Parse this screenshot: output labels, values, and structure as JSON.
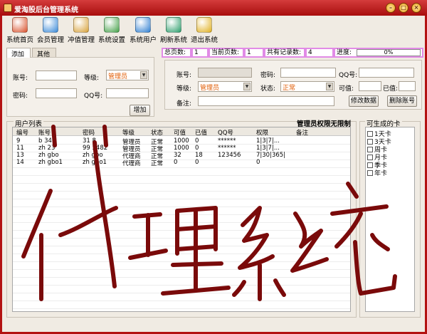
{
  "window": {
    "title": "爱淘股后台管理系统"
  },
  "toolbar": [
    {
      "label": "系统首页",
      "icon": "home-icon",
      "color": "#d9512c"
    },
    {
      "label": "会员管理",
      "icon": "members-icon",
      "color": "#3a8ad8"
    },
    {
      "label": "冲值管理",
      "icon": "recharge-icon",
      "color": "#d8a23a"
    },
    {
      "label": "系统设置",
      "icon": "settings-icon",
      "color": "#43a047"
    },
    {
      "label": "系统用户",
      "icon": "system-user-icon",
      "color": "#2f7fd1"
    },
    {
      "label": "刷新系统",
      "icon": "refresh-icon",
      "color": "#2a9d6a"
    },
    {
      "label": "退出系统",
      "icon": "exit-icon",
      "color": "#e0b020"
    }
  ],
  "tabs": [
    "添加",
    "其他"
  ],
  "add_form": {
    "account_label": "账号:",
    "level_label": "等级:",
    "level_value": "管理员",
    "password_label": "密码:",
    "qq_label": "QQ号:",
    "add_button": "增加"
  },
  "stats": {
    "total_pages_label": "总页数:",
    "total_pages": "1",
    "current_page_label": "当前页数:",
    "current_page": "1",
    "records_label": "共有记录数:",
    "records": "4",
    "progress_label": "进度:",
    "progress_text": "0%",
    "progress_value": 0
  },
  "edit_form": {
    "account_label": "账号:",
    "password_label": "密码:",
    "qq_label": "QQ号:",
    "level_label": "等级:",
    "level_value": "管理员",
    "status_label": "状态:",
    "status_value": "正常",
    "available_label": "可值:",
    "used_label": "已值:",
    "note_label": "备注:",
    "modify_button": "修改数据",
    "delete_button": "删除账号"
  },
  "user_list": {
    "title": "用户列表",
    "permission_note": "管理员权限无限制",
    "columns": [
      "编号",
      "账号",
      "密码",
      "等级",
      "状态",
      "可值",
      "已值",
      "QQ号",
      "权限",
      "备注"
    ],
    "rows": [
      [
        "9",
        "b  341",
        "31  8",
        "管理员",
        "正常",
        "1000",
        "0",
        "******",
        "1|3|7|...",
        ""
      ],
      [
        "11",
        "zh  23",
        "99  5482",
        "管理员",
        "正常",
        "1000",
        "0",
        "******",
        "1|3|7|...",
        ""
      ],
      [
        "13",
        "zh  gbo",
        "zh  gbo",
        "代理商",
        "正常",
        "32",
        "18",
        "123456",
        "7|30|365|",
        ""
      ],
      [
        "14",
        "zh  gbo1",
        "zh  gbo1",
        "代理商",
        "正常",
        "0",
        "0",
        "",
        "0",
        ""
      ]
    ]
  },
  "cards": {
    "title": "可生成的卡",
    "items": [
      "1天卡",
      "3天卡",
      "周卡",
      "月卡",
      "季卡",
      "年卡"
    ]
  },
  "handwriting": {
    "text": "代理系统",
    "color": "#7a0a0a"
  }
}
